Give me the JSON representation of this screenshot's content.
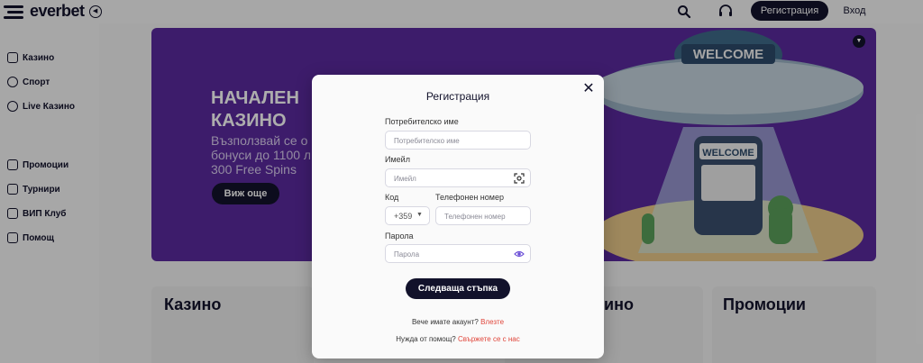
{
  "header": {
    "logo_text": "everbet",
    "register_label": "Регистрация",
    "login_label": "Вход"
  },
  "sidebar": {
    "items": [
      {
        "label": "Казино"
      },
      {
        "label": "Спорт"
      },
      {
        "label": "Live Казино"
      },
      {
        "label": "Промоции"
      },
      {
        "label": "Турнири"
      },
      {
        "label": "ВИП Клуб"
      },
      {
        "label": "Помощ"
      }
    ]
  },
  "banner": {
    "title": "НАЧАЛЕН КАЗИНО",
    "subtitle_line1": "Възползвай се о",
    "subtitle_line2": "бонуси до 1100 л",
    "subtitle_line3": "300 Free Spins",
    "button_label": "Виж още",
    "sign_top": "WELCOME",
    "sign_slot": "WELCOME"
  },
  "cards": [
    {
      "title": "Казино"
    },
    {
      "title": "ино"
    },
    {
      "title": "Промоции"
    }
  ],
  "modal": {
    "title": "Регистрация",
    "username_label": "Потребителско име",
    "username_placeholder": "Потребителско име",
    "email_label": "Имейл",
    "email_placeholder": "Имейл",
    "code_label": "Код",
    "code_value": "+359",
    "phone_label": "Телефонен номер",
    "phone_placeholder": "Телефонен номер",
    "password_label": "Парола",
    "password_placeholder": "Парола",
    "next_button": "Следваща стъпка",
    "have_account_text": "Вече имате акаунт?",
    "login_link": "Влезте",
    "need_help_text": "Нужда от помощ?",
    "contact_link": "Свържете се с нас"
  },
  "colors": {
    "brand_dark": "#12122b",
    "banner_purple": "#5b2a9e",
    "link_red": "#e0453a"
  }
}
